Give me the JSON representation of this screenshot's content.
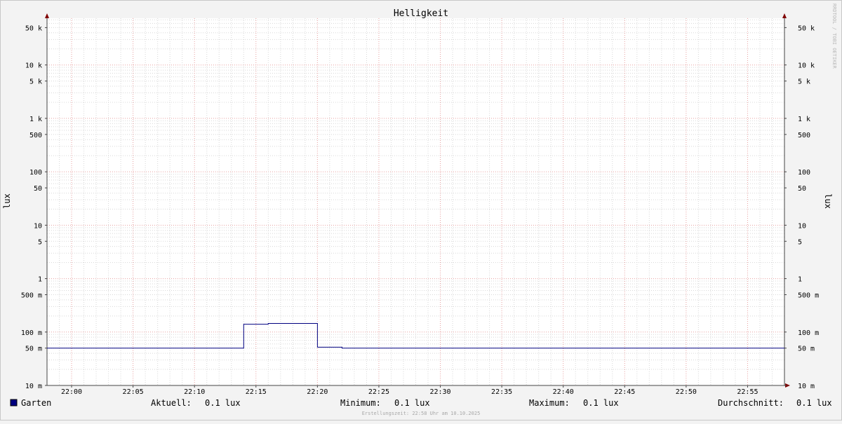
{
  "chart_data": {
    "type": "line",
    "title": "Helligkeit",
    "ylabel": "lux",
    "y_scale": "log",
    "ylim": [
      0.01,
      75000
    ],
    "xlim": [
      "21:58",
      "22:58"
    ],
    "grid": true,
    "y_ticks": [
      {
        "value": 50000,
        "label": "50 k"
      },
      {
        "value": 10000,
        "label": "10 k"
      },
      {
        "value": 5000,
        "label": "5 k"
      },
      {
        "value": 1000,
        "label": "1 k"
      },
      {
        "value": 500,
        "label": "500"
      },
      {
        "value": 100,
        "label": "100"
      },
      {
        "value": 50,
        "label": "50"
      },
      {
        "value": 10,
        "label": "10"
      },
      {
        "value": 5,
        "label": "5"
      },
      {
        "value": 1,
        "label": "1"
      },
      {
        "value": 0.5,
        "label": "500 m"
      },
      {
        "value": 0.1,
        "label": "100 m"
      },
      {
        "value": 0.05,
        "label": "50 m"
      },
      {
        "value": 0.01,
        "label": "10 m"
      }
    ],
    "x_ticks": [
      "22:00",
      "22:05",
      "22:10",
      "22:15",
      "22:20",
      "22:25",
      "22:30",
      "22:35",
      "22:40",
      "22:45",
      "22:50",
      "22:55"
    ],
    "series": [
      {
        "name": "Garten",
        "color": "#000080",
        "points": [
          [
            "21:58",
            0.05
          ],
          [
            "22:14",
            0.05
          ],
          [
            "22:14",
            0.14
          ],
          [
            "22:16",
            0.14
          ],
          [
            "22:16",
            0.145
          ],
          [
            "22:20",
            0.145
          ],
          [
            "22:20",
            0.052
          ],
          [
            "22:22",
            0.052
          ],
          [
            "22:22",
            0.05
          ],
          [
            "22:58",
            0.05
          ]
        ]
      }
    ]
  },
  "legend": {
    "name": "Garten",
    "color": "#000080",
    "stats": [
      {
        "label": "Aktuell:",
        "value": "0.1 lux"
      },
      {
        "label": "Minimum:",
        "value": "0.1 lux"
      },
      {
        "label": "Maximum:",
        "value": "0.1 lux"
      },
      {
        "label": "Durchschnitt:",
        "value": "0.1 lux"
      }
    ]
  },
  "footer": "Erstellungszeit: 22:58 Uhr am 10.10.2025",
  "watermark": "RRDTOOL / TOBI OETIKER",
  "colors": {
    "background": "#f3f3f3",
    "canvas": "#ffffff",
    "minor_grid": "#d8d8d8",
    "major_grid": "#e8a0a0",
    "axis": "#444444",
    "arrow": "#800000"
  }
}
